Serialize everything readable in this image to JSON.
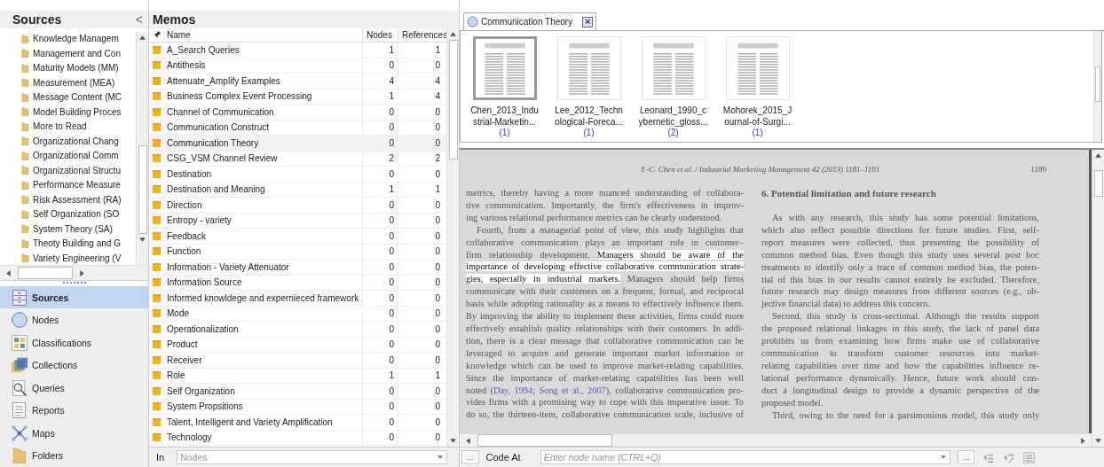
{
  "sources_panel": {
    "title": "Sources",
    "collapse_glyph": "<",
    "folders": [
      "Knowledge Managem",
      "Management and Con",
      "Maturity Models (MM)",
      "Measurement (MEA)",
      "Message Content (MC",
      "Model Building Proces",
      "More to Read",
      "Organizational Chang",
      "Organizational Comm",
      "Organizational Structu",
      "Performance Measure",
      "Risk Assessment (RA)",
      "Self Organization (SO",
      "System Theory (SA)",
      "Theoty Building and G",
      "Variety Engineering (V"
    ]
  },
  "navigation": [
    {
      "label": "Sources",
      "kind": "sources",
      "selected": true
    },
    {
      "label": "Nodes",
      "kind": "nodes",
      "selected": false
    },
    {
      "label": "Classifications",
      "kind": "classifications",
      "selected": false
    },
    {
      "label": "Collections",
      "kind": "collections",
      "selected": false
    },
    {
      "label": "Queries",
      "kind": "queries",
      "selected": false
    },
    {
      "label": "Reports",
      "kind": "reports",
      "selected": false
    },
    {
      "label": "Maps",
      "kind": "maps",
      "selected": false
    },
    {
      "label": "Folders",
      "kind": "folders",
      "selected": false
    }
  ],
  "memos": {
    "title": "Memos",
    "columns": [
      "Name",
      "Nodes",
      "References"
    ],
    "rows": [
      {
        "name": "A_Search Queries",
        "nodes": "1",
        "references": "1",
        "selected": false
      },
      {
        "name": "Antithesis",
        "nodes": "0",
        "references": "0",
        "selected": false
      },
      {
        "name": "Attenuate_Amplify Examples",
        "nodes": "4",
        "references": "4",
        "selected": false
      },
      {
        "name": "Business Complex Event Processing",
        "nodes": "1",
        "references": "4",
        "selected": false
      },
      {
        "name": "Channel of Communication",
        "nodes": "0",
        "references": "0",
        "selected": false
      },
      {
        "name": "Communication Construct",
        "nodes": "0",
        "references": "0",
        "selected": false
      },
      {
        "name": "Communication Theory",
        "nodes": "0",
        "references": "0",
        "selected": true
      },
      {
        "name": "CSG_VSM Channel Review",
        "nodes": "2",
        "references": "2",
        "selected": false
      },
      {
        "name": "Destination",
        "nodes": "0",
        "references": "0",
        "selected": false
      },
      {
        "name": "Destination and Meaning",
        "nodes": "1",
        "references": "1",
        "selected": false
      },
      {
        "name": "Direction",
        "nodes": "0",
        "references": "0",
        "selected": false
      },
      {
        "name": "Entropy - variety",
        "nodes": "0",
        "references": "0",
        "selected": false
      },
      {
        "name": "Feedback",
        "nodes": "0",
        "references": "0",
        "selected": false
      },
      {
        "name": "Function",
        "nodes": "0",
        "references": "0",
        "selected": false
      },
      {
        "name": "Information - Variety Attenuator",
        "nodes": "0",
        "references": "0",
        "selected": false
      },
      {
        "name": "Information Source",
        "nodes": "0",
        "references": "0",
        "selected": false
      },
      {
        "name": "Informed knowldege and expernieced framework",
        "nodes": "0",
        "references": "0",
        "selected": false
      },
      {
        "name": "Mode",
        "nodes": "0",
        "references": "0",
        "selected": false
      },
      {
        "name": "Operationalization",
        "nodes": "0",
        "references": "0",
        "selected": false
      },
      {
        "name": "Product",
        "nodes": "0",
        "references": "0",
        "selected": false
      },
      {
        "name": "Receiver",
        "nodes": "0",
        "references": "0",
        "selected": false
      },
      {
        "name": "Role",
        "nodes": "1",
        "references": "1",
        "selected": false
      },
      {
        "name": "Self Organization",
        "nodes": "0",
        "references": "0",
        "selected": false
      },
      {
        "name": "System Propsitions",
        "nodes": "0",
        "references": "0",
        "selected": false
      },
      {
        "name": "Talent, Intelligent and Variety Amplification",
        "nodes": "0",
        "references": "0",
        "selected": false
      },
      {
        "name": "Technology",
        "nodes": "0",
        "references": "0",
        "selected": false
      }
    ],
    "in_label": "In",
    "in_placeholder": "Nodes"
  },
  "tab": {
    "label": "Communication Theory",
    "close_glyph": "×"
  },
  "thumbnails": [
    {
      "caption": [
        "Chen_2013_Indu",
        "strial-Marketin..."
      ],
      "count": "(1)",
      "selected": true
    },
    {
      "caption": [
        "Lee_2012_Techn",
        "ological-Foreca..."
      ],
      "count": "(1)",
      "selected": false
    },
    {
      "caption": [
        "Leonard_1990_c",
        "ybernetic_gloss..."
      ],
      "count": "(2)",
      "selected": false
    },
    {
      "caption": [
        "Mohorek_2015_J",
        "ournal-of-Surgi..."
      ],
      "count": "(1)",
      "selected": false
    }
  ],
  "document": {
    "running_head": "Y.-C. Chen et al. / Industrial Marketing Management 42 (2013) 1181–1191",
    "page_number": "1189",
    "left_column": [
      {
        "indent": false,
        "complete": true,
        "lines": [
          "metrics, thereby having a more nuanced understanding of collabora-",
          "tive communication. Importantly, the firm's effectiveness in improv-",
          "ing various relational performance metrics can be clearly understood."
        ]
      },
      {
        "indent": true,
        "complete": false,
        "lines": [
          "Fourth, from a managerial point of view, this study highlights that",
          "collaborative communication plays an important role in customer–",
          [
            {
              "kind": "plain",
              "text": "firm relationship development. "
            },
            {
              "kind": "highlight",
              "text": "Managers should be aware of the"
            }
          ],
          [
            {
              "kind": "highlight",
              "text": "importance of developing effective collaborative communication strate-"
            }
          ],
          [
            {
              "kind": "highlight",
              "text": "gies, especially in industrial markets."
            },
            {
              "kind": "plain",
              "text": " Managers should help firms"
            }
          ],
          "communicate with their customers on a frequent, formal, and reciprocal",
          "basis while adopting rationality as a means to effectively influence them.",
          "By improving the ability to implement these activities, firms could more",
          "effectively establish quality relationships with their customers. In addi-",
          "tion, there is a clear message that collaborative communication can be",
          "leveraged to acquire and generate important market information or",
          "knowledge which can be used to improve market-relating capabilities.",
          "Since the importance of market-relating capabilities has been well",
          [
            {
              "kind": "plain",
              "text": "noted ("
            },
            {
              "kind": "link",
              "text": "Day, 1994"
            },
            {
              "kind": "plain",
              "text": "; "
            },
            {
              "kind": "link",
              "text": "Song et al., 2007"
            },
            {
              "kind": "plain",
              "text": "), collaborative communication pro-"
            }
          ],
          "vides firms with a promising way to cope with this imperative issue. To",
          "do so, the thirteen-item, collaborative communication scale, inclusive of"
        ]
      }
    ],
    "right_heading": "6. Potential limitation and future research",
    "right_column": [
      {
        "indent": true,
        "complete": true,
        "lines": [
          "As with any research, this study has some potential limitations,",
          "which also reflect possible directions for future studies. First, self-",
          "report measures were collected, thus presenting the possibility of",
          "common method bias. Even though this study uses several post hoc",
          "treatments to identify only a trace of common method bias, the poten-",
          "tial of this bias in our results cannot entirely be excluded. Therefore,",
          "future research may design measures from different sources (e.g., ob-",
          "jective financial data) to address this concern."
        ]
      },
      {
        "indent": true,
        "complete": true,
        "lines": [
          "Second, this study is cross-sectional. Although the results support",
          "the proposed relational linkages in this study, the lack of panel data",
          "prohibits us from examining how firms make use of collaborative",
          "communication to transform customer resources into market-",
          "relating capabilities over time and how the capabilities influence re-",
          "lational performance dynamically. Hence, future work should con-",
          "duct a longitudinal design to provide a dynamic perspective of the",
          "proposed model."
        ]
      },
      {
        "indent": true,
        "complete": false,
        "lines": [
          "Third, owing to the need for a parsimonious model, this study only"
        ]
      }
    ]
  },
  "code_bar": {
    "more_left": "...",
    "label": "Code At",
    "placeholder": "Enter node name (CTRL+Q)",
    "more_right": "..."
  }
}
